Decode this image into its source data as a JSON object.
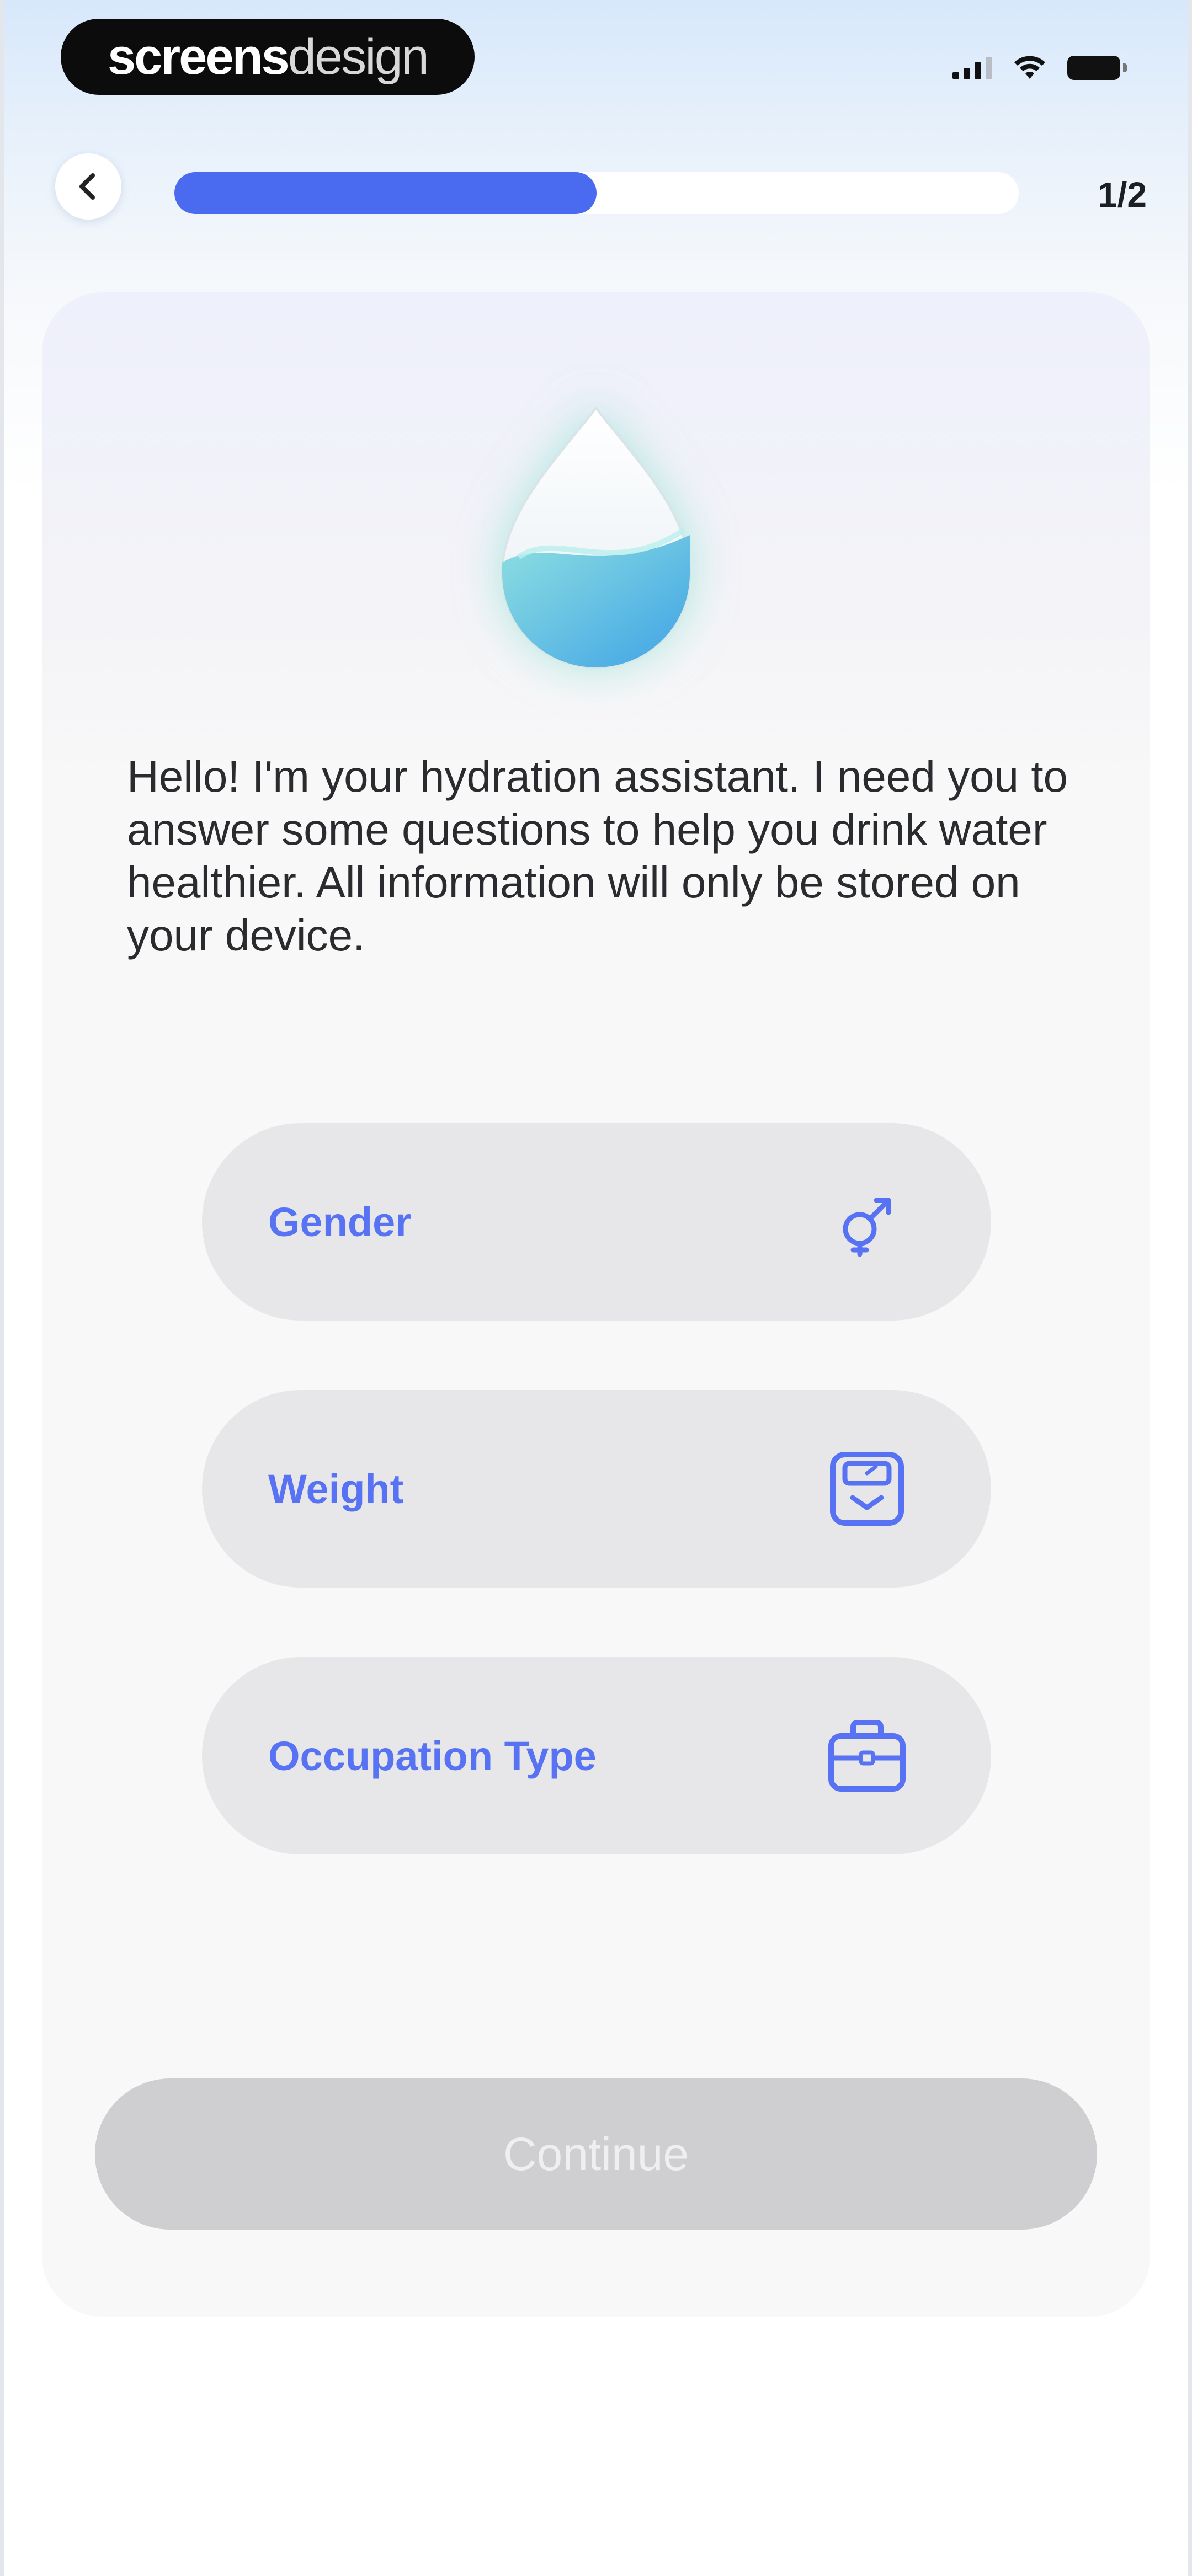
{
  "status_bar": {
    "brand_bold": "screens",
    "brand_light": "design",
    "signal_icon": "cellular-signal-icon",
    "wifi_icon": "wifi-icon",
    "battery_icon": "battery-icon"
  },
  "header": {
    "back_icon": "chevron-left-icon",
    "progress_fraction": 0.5,
    "step": "1/2"
  },
  "assistant": {
    "icon": "water-drop-icon",
    "message": "Hello! I'm your hydration assistant. I need you to answer some questions to help you drink water healthier. All information will only be stored on your device."
  },
  "fields": [
    {
      "label": "Gender",
      "icon": "gender-icon"
    },
    {
      "label": "Weight",
      "icon": "scale-icon"
    },
    {
      "label": "Occupation Type",
      "icon": "briefcase-icon"
    }
  ],
  "continue_label": "Continue",
  "colors": {
    "accent": "#4a6af0",
    "field_text": "#5772f2",
    "field_bg": "#e7e7e9",
    "disabled_button": "#cfcfd1"
  }
}
